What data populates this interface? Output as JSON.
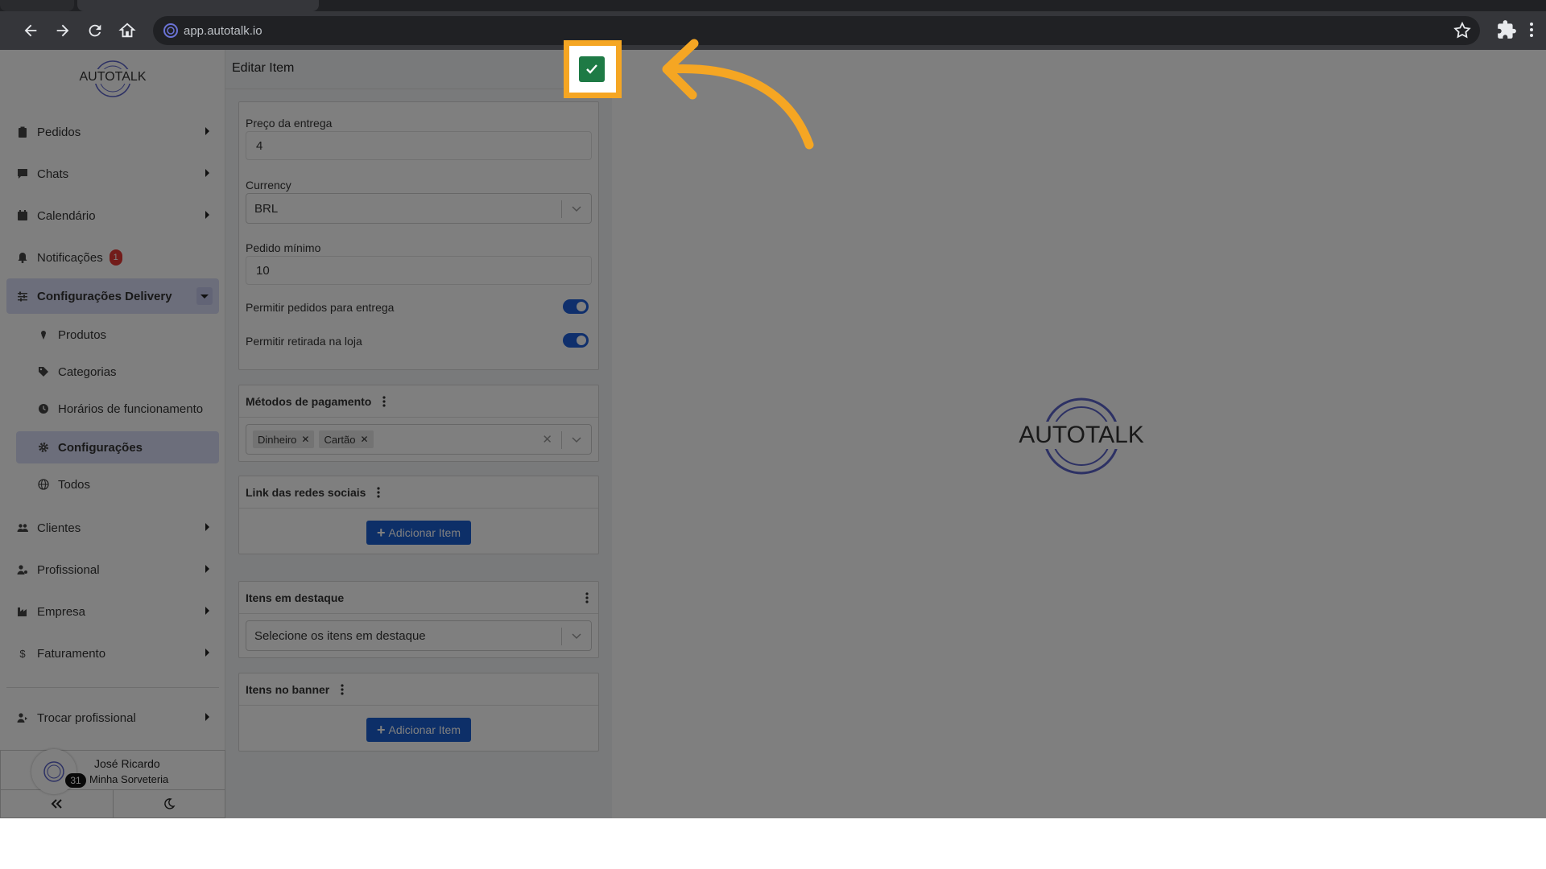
{
  "browser": {
    "url": "app.autotalk.io"
  },
  "sidebar": {
    "logo_text": "AUTOTALK",
    "items": [
      {
        "label": "Pedidos"
      },
      {
        "label": "Chats"
      },
      {
        "label": "Calendário"
      },
      {
        "label": "Notificações",
        "badge": "1"
      },
      {
        "label": "Configurações Delivery"
      }
    ],
    "sub_items": [
      {
        "label": "Produtos"
      },
      {
        "label": "Categorias"
      },
      {
        "label": "Horários de funcionamento"
      },
      {
        "label": "Configurações"
      },
      {
        "label": "Todos"
      }
    ],
    "items_bottom": [
      {
        "label": "Clientes"
      },
      {
        "label": "Profissional"
      },
      {
        "label": "Empresa"
      },
      {
        "label": "Faturamento"
      }
    ],
    "switch_label": "Trocar profissional",
    "user": {
      "name": "José Ricardo",
      "company": "Minha Sorveteria",
      "count": "31"
    }
  },
  "main": {
    "title": "Editar Item",
    "delivery_price_label": "Preço da entrega",
    "delivery_price_value": "4",
    "currency_label": "Currency",
    "currency_value": "BRL",
    "min_order_label": "Pedido mínimo",
    "min_order_value": "10",
    "allow_delivery_label": "Permitir pedidos para entrega",
    "allow_pickup_label": "Permitir retirada na loja",
    "payment_header": "Métodos de pagamento",
    "payment_chips": [
      "Dinheiro",
      "Cartão"
    ],
    "social_header": "Link das redes sociais",
    "add_item_label": "Adicionar Item",
    "featured_header": "Itens em destaque",
    "featured_placeholder": "Selecione os itens em destaque",
    "banner_header": "Itens no banner"
  },
  "right_logo_text": "AUTOTALK",
  "colors": {
    "accent": "#1b5fd0",
    "highlight": "#f5a623",
    "save": "#1e7a45"
  }
}
